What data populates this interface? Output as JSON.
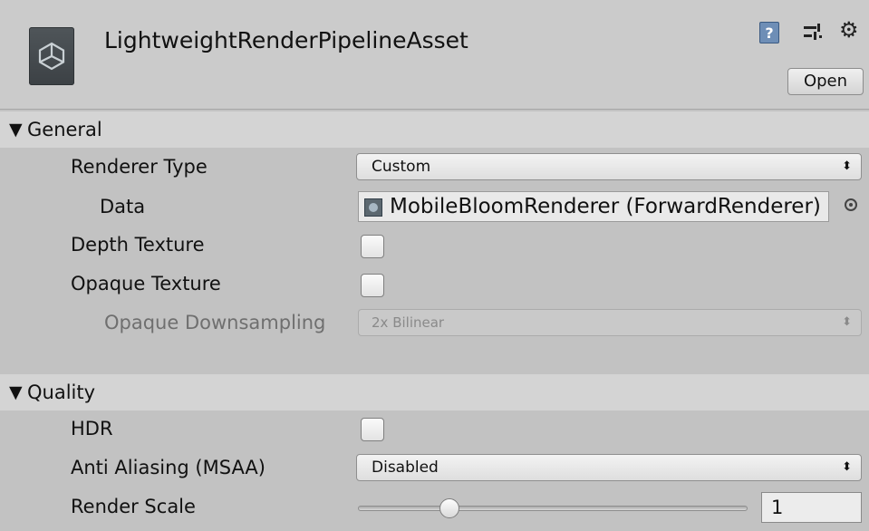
{
  "header": {
    "asset_title": "LightweightRenderPipelineAsset",
    "help_icon_glyph": "?",
    "gear_icon_glyph": "⚙",
    "open_button": "Open"
  },
  "sections": {
    "general": {
      "title": "General",
      "triangle": "▼",
      "renderer_type_label": "Renderer Type",
      "renderer_type_value": "Custom",
      "data_label": "Data",
      "data_value": "MobileBloomRenderer (ForwardRenderer)",
      "depth_texture_label": "Depth Texture",
      "depth_texture_checked": false,
      "opaque_texture_label": "Opaque Texture",
      "opaque_texture_checked": false,
      "opaque_downsampling_label": "Opaque Downsampling",
      "opaque_downsampling_value": "2x Bilinear"
    },
    "quality": {
      "title": "Quality",
      "triangle": "▼",
      "hdr_label": "HDR",
      "hdr_checked": false,
      "anti_aliasing_label": "Anti Aliasing (MSAA)",
      "anti_aliasing_value": "Disabled",
      "render_scale_label": "Render Scale",
      "render_scale_value": "1"
    }
  },
  "dropdown_arrow": "⬍",
  "colors": {
    "panel_bg": "#c2c2c2",
    "header_bg": "#cbcbcb",
    "section_bg": "#d4d4d4",
    "help_icon": "#6e8eb6"
  }
}
